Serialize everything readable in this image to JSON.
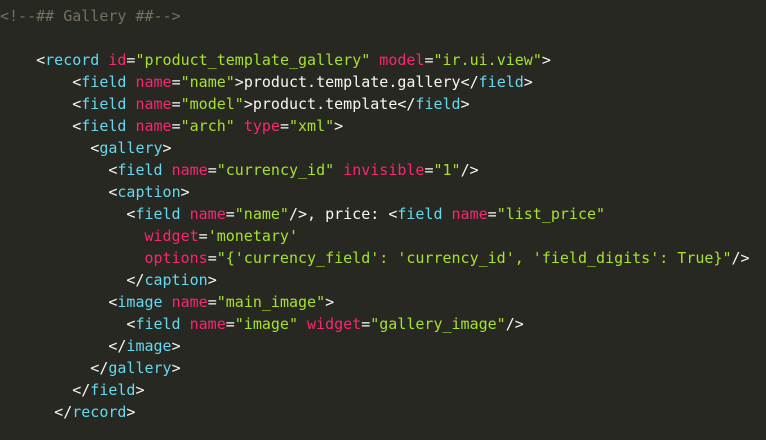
{
  "editor": {
    "language": "xml",
    "theme_colors": {
      "background": "#272822",
      "comment": "#75715e",
      "punctuation": "#f8f8f2",
      "tag": "#66d9ef",
      "attribute": "#f92672",
      "string": "#a6e22e",
      "text": "#f8f8f2"
    },
    "lines": [
      {
        "indent": 0,
        "tokens": [
          {
            "t": "comment",
            "v": "<!--## Gallery ##-->"
          }
        ]
      },
      {
        "indent": 0,
        "tokens": []
      },
      {
        "indent": 4,
        "tokens": [
          {
            "t": "punct",
            "v": "<"
          },
          {
            "t": "tag",
            "v": "record"
          },
          {
            "t": "punct",
            "v": " "
          },
          {
            "t": "attr",
            "v": "id"
          },
          {
            "t": "punct",
            "v": "="
          },
          {
            "t": "string",
            "v": "\"product_template_gallery\""
          },
          {
            "t": "punct",
            "v": " "
          },
          {
            "t": "attr",
            "v": "model"
          },
          {
            "t": "punct",
            "v": "="
          },
          {
            "t": "string",
            "v": "\"ir.ui.view\""
          },
          {
            "t": "punct",
            "v": ">"
          }
        ]
      },
      {
        "indent": 8,
        "tokens": [
          {
            "t": "punct",
            "v": "<"
          },
          {
            "t": "tag",
            "v": "field"
          },
          {
            "t": "punct",
            "v": " "
          },
          {
            "t": "attr",
            "v": "name"
          },
          {
            "t": "punct",
            "v": "="
          },
          {
            "t": "string",
            "v": "\"name\""
          },
          {
            "t": "punct",
            "v": ">"
          },
          {
            "t": "text",
            "v": "product.template.gallery"
          },
          {
            "t": "punct",
            "v": "</"
          },
          {
            "t": "tag",
            "v": "field"
          },
          {
            "t": "punct",
            "v": ">"
          }
        ]
      },
      {
        "indent": 8,
        "tokens": [
          {
            "t": "punct",
            "v": "<"
          },
          {
            "t": "tag",
            "v": "field"
          },
          {
            "t": "punct",
            "v": " "
          },
          {
            "t": "attr",
            "v": "name"
          },
          {
            "t": "punct",
            "v": "="
          },
          {
            "t": "string",
            "v": "\"model\""
          },
          {
            "t": "punct",
            "v": ">"
          },
          {
            "t": "text",
            "v": "product.template"
          },
          {
            "t": "punct",
            "v": "</"
          },
          {
            "t": "tag",
            "v": "field"
          },
          {
            "t": "punct",
            "v": ">"
          }
        ]
      },
      {
        "indent": 8,
        "tokens": [
          {
            "t": "punct",
            "v": "<"
          },
          {
            "t": "tag",
            "v": "field"
          },
          {
            "t": "punct",
            "v": " "
          },
          {
            "t": "attr",
            "v": "name"
          },
          {
            "t": "punct",
            "v": "="
          },
          {
            "t": "string",
            "v": "\"arch\""
          },
          {
            "t": "punct",
            "v": " "
          },
          {
            "t": "attr",
            "v": "type"
          },
          {
            "t": "punct",
            "v": "="
          },
          {
            "t": "string",
            "v": "\"xml\""
          },
          {
            "t": "punct",
            "v": ">"
          }
        ]
      },
      {
        "indent": 10,
        "tokens": [
          {
            "t": "punct",
            "v": "<"
          },
          {
            "t": "tag",
            "v": "gallery"
          },
          {
            "t": "punct",
            "v": ">"
          }
        ]
      },
      {
        "indent": 12,
        "tokens": [
          {
            "t": "punct",
            "v": "<"
          },
          {
            "t": "tag",
            "v": "field"
          },
          {
            "t": "punct",
            "v": " "
          },
          {
            "t": "attr",
            "v": "name"
          },
          {
            "t": "punct",
            "v": "="
          },
          {
            "t": "string",
            "v": "\"currency_id\""
          },
          {
            "t": "punct",
            "v": " "
          },
          {
            "t": "attr",
            "v": "invisible"
          },
          {
            "t": "punct",
            "v": "="
          },
          {
            "t": "string",
            "v": "\"1\""
          },
          {
            "t": "punct",
            "v": "/>"
          }
        ]
      },
      {
        "indent": 12,
        "tokens": [
          {
            "t": "punct",
            "v": "<"
          },
          {
            "t": "tag",
            "v": "caption"
          },
          {
            "t": "punct",
            "v": ">"
          }
        ]
      },
      {
        "indent": 14,
        "tokens": [
          {
            "t": "punct",
            "v": "<"
          },
          {
            "t": "tag",
            "v": "field"
          },
          {
            "t": "punct",
            "v": " "
          },
          {
            "t": "attr",
            "v": "name"
          },
          {
            "t": "punct",
            "v": "="
          },
          {
            "t": "string",
            "v": "\"name\""
          },
          {
            "t": "punct",
            "v": "/>"
          },
          {
            "t": "text",
            "v": ", price: "
          },
          {
            "t": "punct",
            "v": "<"
          },
          {
            "t": "tag",
            "v": "field"
          },
          {
            "t": "punct",
            "v": " "
          },
          {
            "t": "attr",
            "v": "name"
          },
          {
            "t": "punct",
            "v": "="
          },
          {
            "t": "string",
            "v": "\"list_price\""
          }
        ]
      },
      {
        "indent": 16,
        "tokens": [
          {
            "t": "attr",
            "v": "widget"
          },
          {
            "t": "punct",
            "v": "="
          },
          {
            "t": "string",
            "v": "'monetary'"
          }
        ]
      },
      {
        "indent": 16,
        "tokens": [
          {
            "t": "attr",
            "v": "options"
          },
          {
            "t": "punct",
            "v": "="
          },
          {
            "t": "string",
            "v": "\"{'currency_field': 'currency_id', 'field_digits': True}\""
          },
          {
            "t": "punct",
            "v": "/>"
          }
        ]
      },
      {
        "indent": 14,
        "tokens": [
          {
            "t": "punct",
            "v": "</"
          },
          {
            "t": "tag",
            "v": "caption"
          },
          {
            "t": "punct",
            "v": ">"
          }
        ]
      },
      {
        "indent": 12,
        "tokens": [
          {
            "t": "punct",
            "v": "<"
          },
          {
            "t": "tag",
            "v": "image"
          },
          {
            "t": "punct",
            "v": " "
          },
          {
            "t": "attr",
            "v": "name"
          },
          {
            "t": "punct",
            "v": "="
          },
          {
            "t": "string",
            "v": "\"main_image\""
          },
          {
            "t": "punct",
            "v": ">"
          }
        ]
      },
      {
        "indent": 14,
        "tokens": [
          {
            "t": "punct",
            "v": "<"
          },
          {
            "t": "tag",
            "v": "field"
          },
          {
            "t": "punct",
            "v": " "
          },
          {
            "t": "attr",
            "v": "name"
          },
          {
            "t": "punct",
            "v": "="
          },
          {
            "t": "string",
            "v": "\"image\""
          },
          {
            "t": "punct",
            "v": " "
          },
          {
            "t": "attr",
            "v": "widget"
          },
          {
            "t": "punct",
            "v": "="
          },
          {
            "t": "string",
            "v": "\"gallery_image\""
          },
          {
            "t": "punct",
            "v": "/>"
          }
        ]
      },
      {
        "indent": 12,
        "tokens": [
          {
            "t": "punct",
            "v": "</"
          },
          {
            "t": "tag",
            "v": "image"
          },
          {
            "t": "punct",
            "v": ">"
          }
        ]
      },
      {
        "indent": 10,
        "tokens": [
          {
            "t": "punct",
            "v": "</"
          },
          {
            "t": "tag",
            "v": "gallery"
          },
          {
            "t": "punct",
            "v": ">"
          }
        ]
      },
      {
        "indent": 8,
        "tokens": [
          {
            "t": "punct",
            "v": "</"
          },
          {
            "t": "tag",
            "v": "field"
          },
          {
            "t": "punct",
            "v": ">"
          }
        ]
      },
      {
        "indent": 6,
        "tokens": [
          {
            "t": "punct",
            "v": "</"
          },
          {
            "t": "tag",
            "v": "record"
          },
          {
            "t": "punct",
            "v": ">"
          }
        ]
      }
    ]
  }
}
